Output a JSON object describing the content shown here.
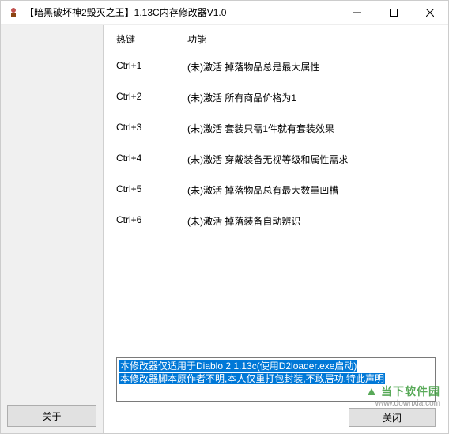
{
  "window": {
    "title": "【暗黑破坏神2毁灭之王】1.13C内存修改器V1.0"
  },
  "headers": {
    "hotkey": "热键",
    "function": "功能"
  },
  "rows": [
    {
      "hotkey": "Ctrl+1",
      "func": "(未)激活 掉落物品总是最大属性"
    },
    {
      "hotkey": "Ctrl+2",
      "func": "(未)激活 所有商品价格为1"
    },
    {
      "hotkey": "Ctrl+3",
      "func": "(未)激活 套装只需1件就有套装效果"
    },
    {
      "hotkey": "Ctrl+4",
      "func": "(未)激活 穿戴装备无视等级和属性需求"
    },
    {
      "hotkey": "Ctrl+5",
      "func": "(未)激活 掉落物品总有最大数量凹槽"
    },
    {
      "hotkey": "Ctrl+6",
      "func": "(未)激活 掉落装备自动辨识"
    }
  ],
  "notice": {
    "line1": "本修改器仅适用于Diablo 2 1.13c(使用D2loader.exe启动)",
    "line2": "本修改器脚本原作者不明,本人仅重打包封装,不敢居功,特此声明"
  },
  "buttons": {
    "about": "关于",
    "close": "关闭"
  },
  "watermark": {
    "cn": "当下软件园",
    "en": "www.downxia.com"
  }
}
